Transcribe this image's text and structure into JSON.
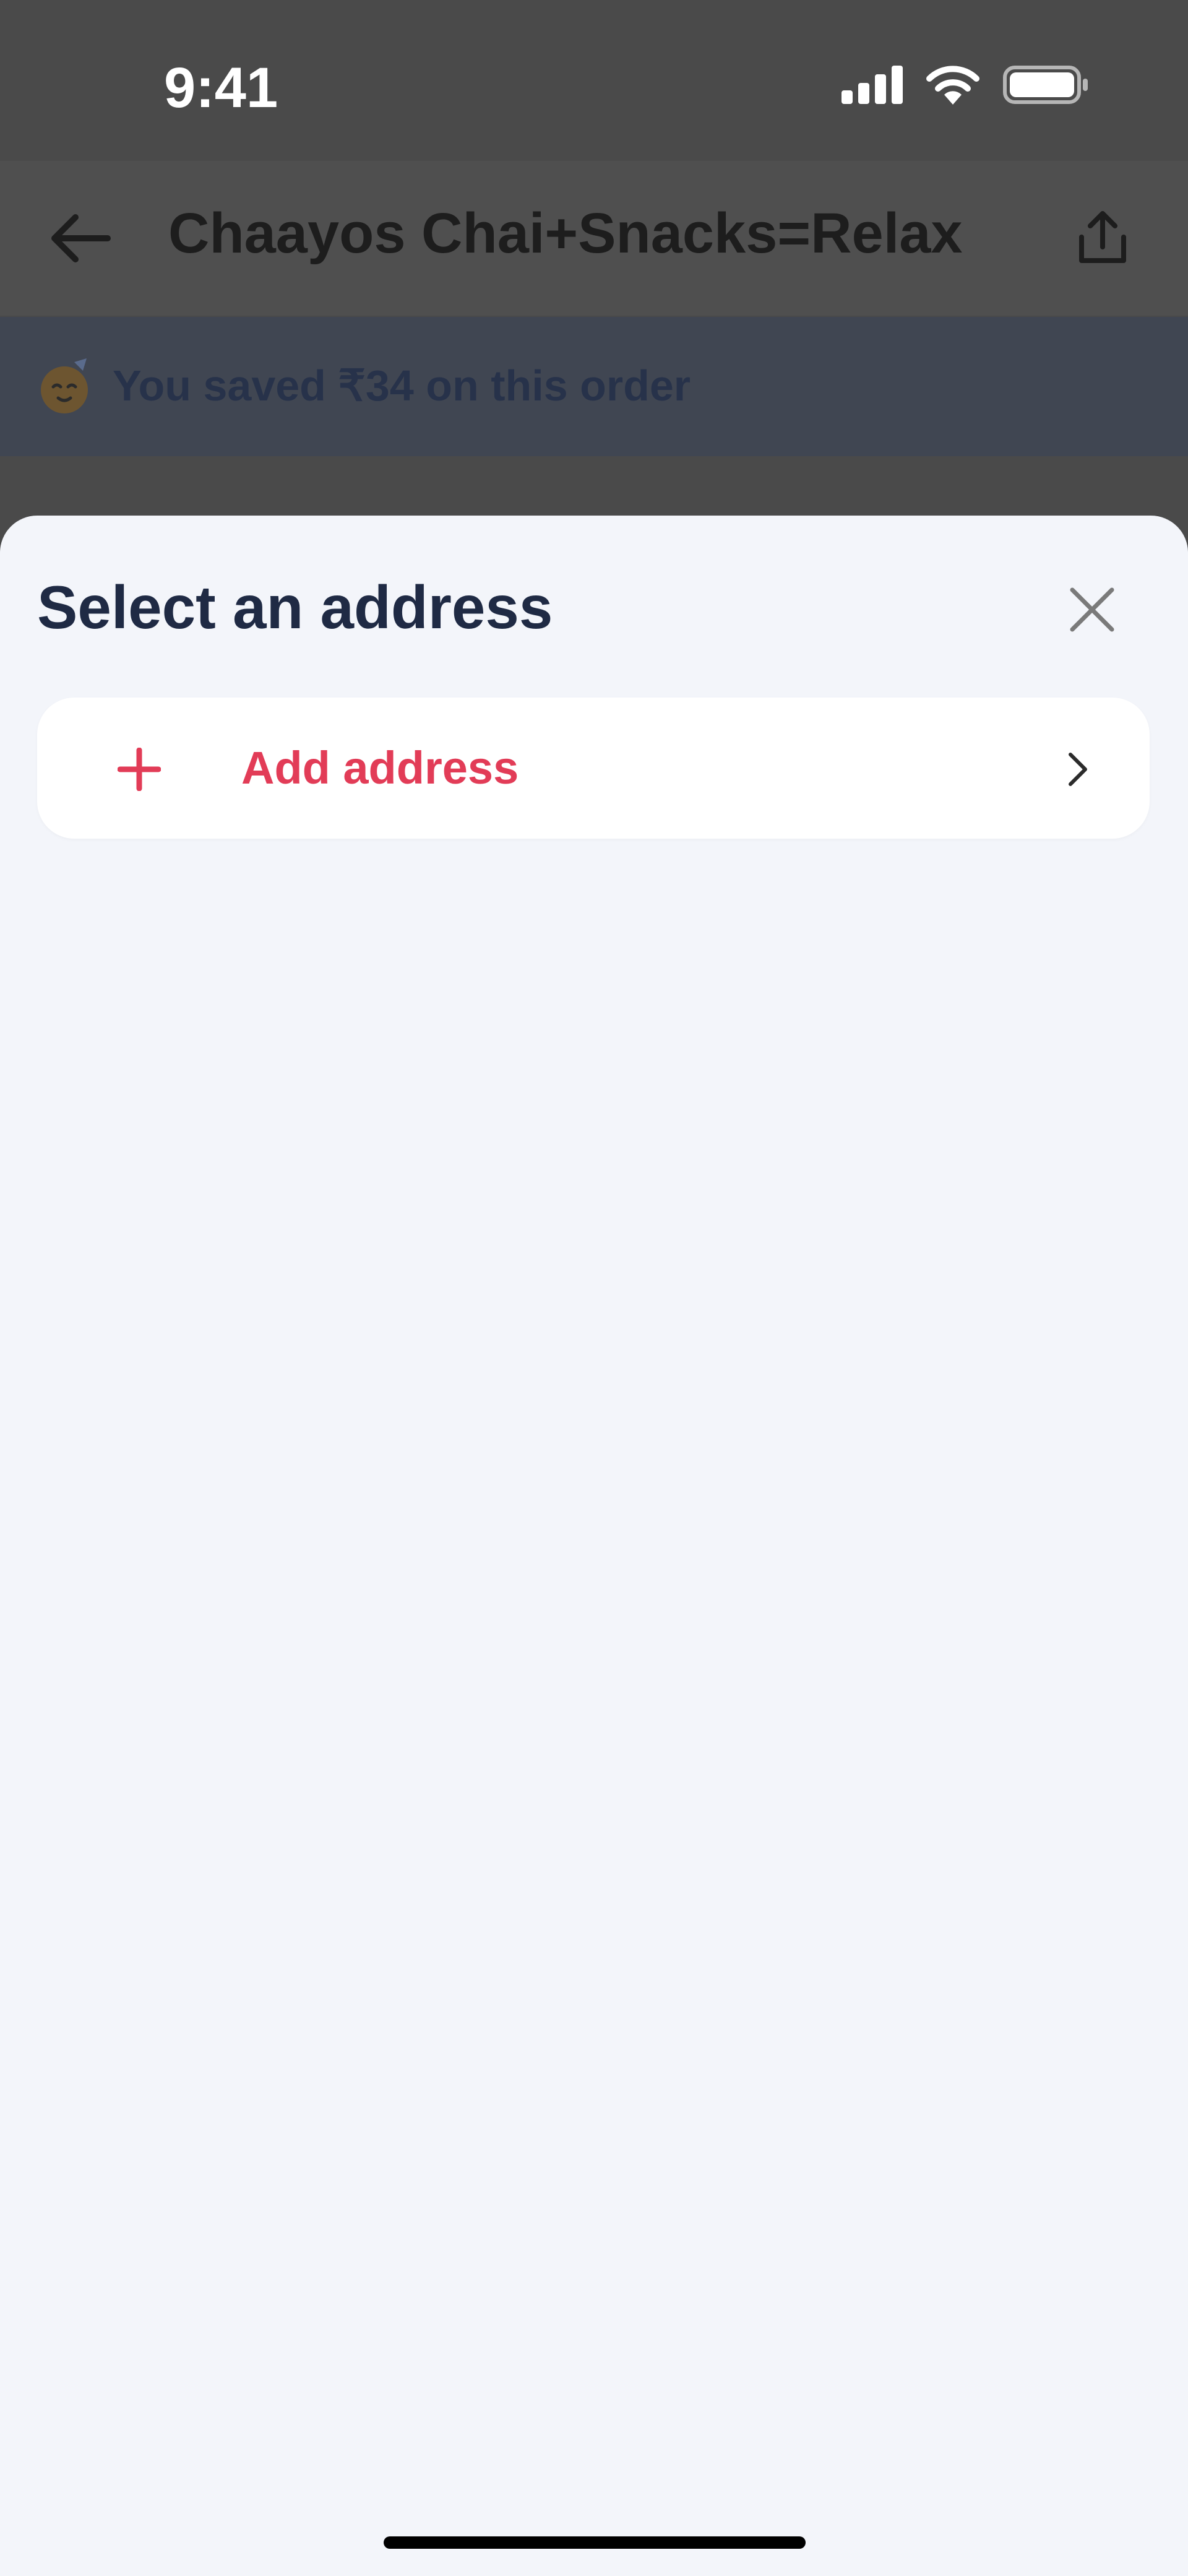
{
  "status_bar": {
    "time": "9:41",
    "icons": [
      "signal-icon",
      "wifi-icon",
      "battery-icon"
    ]
  },
  "header": {
    "back_icon": "arrow-left-icon",
    "title": "Chaayos Chai+Snacks=Relax",
    "share_icon": "share-icon"
  },
  "savings_banner": {
    "emoji_icon": "celebration-emoji-icon",
    "text": "You saved ₹34 on this order"
  },
  "address_sheet": {
    "title": "Select an address",
    "close_icon": "close-icon",
    "add_address": {
      "icon": "plus-icon",
      "label": "Add address",
      "chevron_icon": "chevron-right-icon"
    }
  },
  "colors": {
    "overlay_header": "#4f4f4f",
    "banner": "#404652",
    "sheet_background": "#f3f5fa",
    "title_text": "#1f2a44",
    "accent_red": "#e23c57"
  }
}
